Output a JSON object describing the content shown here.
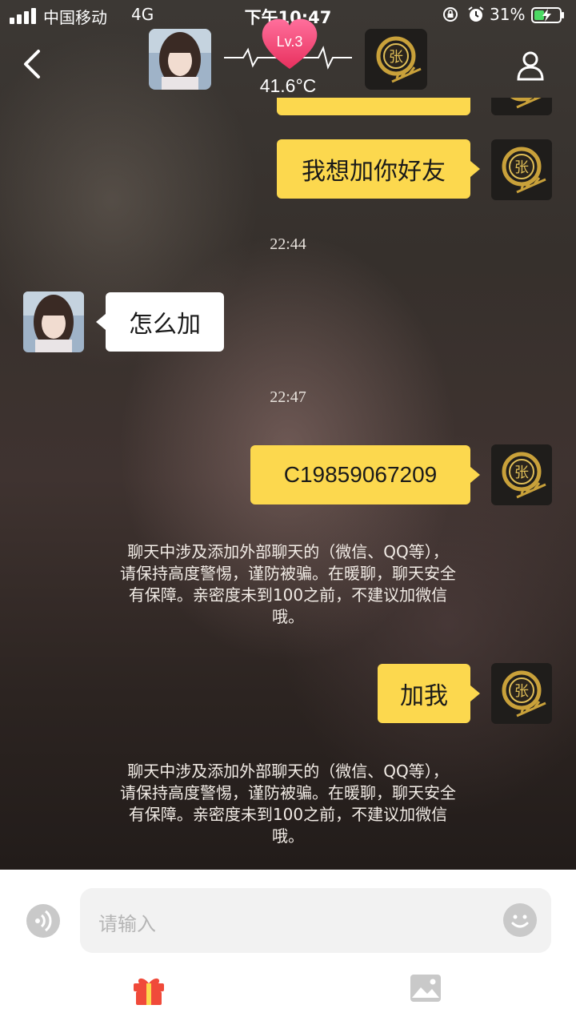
{
  "status_bar": {
    "carrier": "中国移动",
    "network": "4G",
    "time": "下午10:47",
    "battery_percent": "31%"
  },
  "header": {
    "level": "Lv.3",
    "temperature": "41.6°C"
  },
  "messages": [
    {
      "type": "out",
      "text": "我想加你好友"
    },
    {
      "type": "time",
      "text": "22:44"
    },
    {
      "type": "in",
      "text": "怎么加"
    },
    {
      "type": "time",
      "text": "22:47"
    },
    {
      "type": "out",
      "text": "C19859067209"
    },
    {
      "type": "notice",
      "lines": [
        "聊天中涉及添加外部聊天的（微信、QQ等），",
        "请保持高度警惕，谨防被骗。在暖聊，聊天安全",
        "有保障。亲密度未到100之前，不建议加微信",
        "哦。"
      ]
    },
    {
      "type": "out",
      "text": "加我"
    },
    {
      "type": "notice",
      "lines": [
        "聊天中涉及添加外部聊天的（微信、QQ等），",
        "请保持高度警惕，谨防被骗。在暖聊，聊天安全",
        "有保障。亲密度未到100之前，不建议加微信",
        "哦。"
      ]
    }
  ],
  "input": {
    "placeholder": "请输入"
  },
  "colors": {
    "outgoing_bubble": "#fcd84e",
    "incoming_bubble": "#ffffff",
    "level_heart": "#f0457a",
    "gift_icon": "#f04a3a"
  }
}
